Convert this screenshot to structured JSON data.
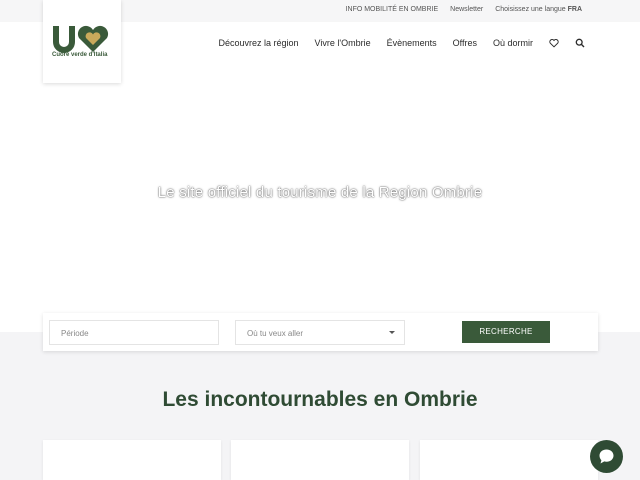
{
  "topbar": {
    "info_mobility": "INFO MOBILITÉ EN OMBRIE",
    "newsletter": "Newsletter",
    "language_label": "Choisissez une langue",
    "language_value": "FRA"
  },
  "logo": {
    "tagline": "Cuore verde d'Italia",
    "icon": "um-heart-logo"
  },
  "nav": {
    "items": [
      "Découvrez la région",
      "Vivre l'Ombrie",
      "Évènements",
      "Offres",
      "Où dormir"
    ],
    "favorites_icon": "heart-icon",
    "search_icon": "search-icon"
  },
  "hero": {
    "title": "Le site officiel du tourisme de la Region Ombrie"
  },
  "search": {
    "period_placeholder": "Période",
    "where_placeholder": "Où tu veux aller",
    "button_label": "RECHERCHE"
  },
  "section": {
    "title": "Les incontournables en Ombrie"
  },
  "chat": {
    "icon": "chat-bubble-icon"
  },
  "colors": {
    "brand_green": "#3a5a3a",
    "title_green": "#2f4b34",
    "light_bg": "#f4f4f6"
  }
}
